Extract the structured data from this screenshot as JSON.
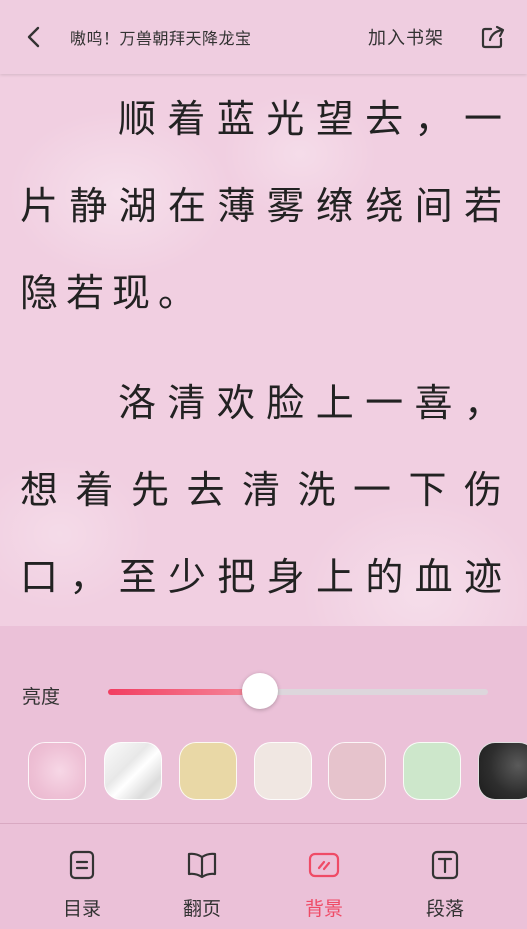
{
  "header": {
    "back_icon": "chevron-left-icon",
    "title": "嗷呜！万兽朝拜天降龙宝",
    "add_to_shelf": "加入书架",
    "share_icon": "share-icon"
  },
  "reader": {
    "paragraphs": [
      "顺着蓝光望去，一片静湖在薄雾缭绕间若隐若现。",
      "洛清欢脸上一喜，想着先去清洗一下伤口，至少把身上的血迹抹"
    ]
  },
  "settings": {
    "brightness_label": "亮度",
    "brightness_level": 0.4,
    "backgrounds": [
      {
        "name": "rose",
        "selected": true
      },
      {
        "name": "marble",
        "selected": false
      },
      {
        "name": "tan",
        "selected": false
      },
      {
        "name": "cream",
        "selected": false
      },
      {
        "name": "mauve",
        "selected": false
      },
      {
        "name": "mint",
        "selected": false
      },
      {
        "name": "dark",
        "selected": false
      }
    ],
    "accent_color": "#ef4b66"
  },
  "bottom_nav": {
    "items": [
      {
        "label": "目录",
        "icon": "table-of-contents-icon"
      },
      {
        "label": "翻页",
        "icon": "book-open-icon"
      },
      {
        "label": "背景",
        "icon": "background-icon",
        "active": true
      },
      {
        "label": "段落",
        "icon": "text-format-icon"
      }
    ]
  }
}
